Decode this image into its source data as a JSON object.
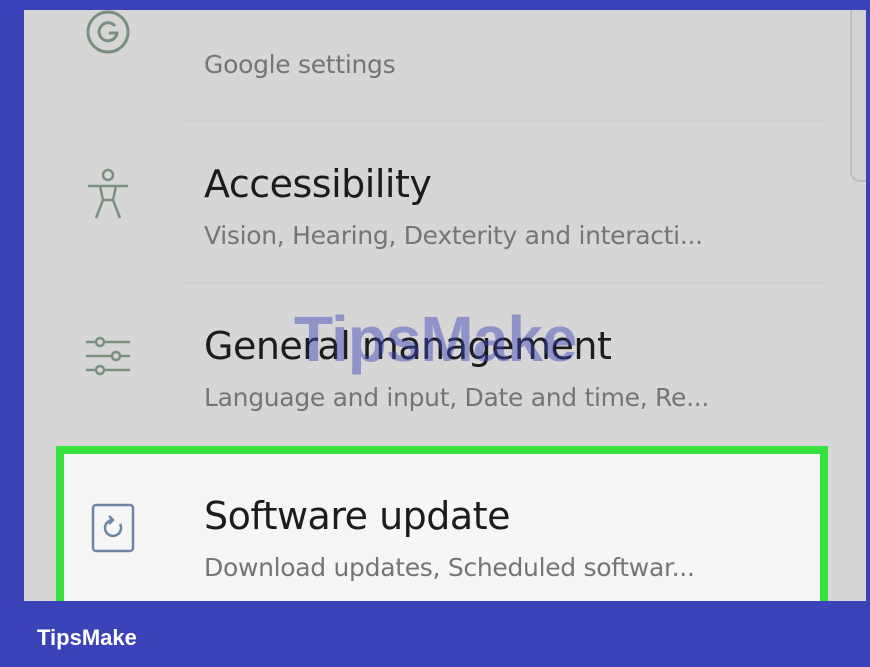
{
  "settings_list": {
    "items": [
      {
        "title": "",
        "subtitle": "Google settings",
        "icon": "google-icon"
      },
      {
        "title": "Accessibility",
        "subtitle": "Vision, Hearing, Dexterity and interacti...",
        "icon": "accessibility-icon"
      },
      {
        "title": "General management",
        "subtitle": "Language and input, Date and time, Re...",
        "icon": "sliders-icon"
      },
      {
        "title": "Software update",
        "subtitle": "Download updates, Scheduled softwar...",
        "icon": "software-update-icon"
      }
    ]
  },
  "watermark": "TipsMake",
  "brand": "TipsMake",
  "colors": {
    "frame": "#3a43b8",
    "highlight_border": "#37e23f",
    "screen_bg": "#d6d6d6",
    "icon_color": "#7b8f7e"
  }
}
